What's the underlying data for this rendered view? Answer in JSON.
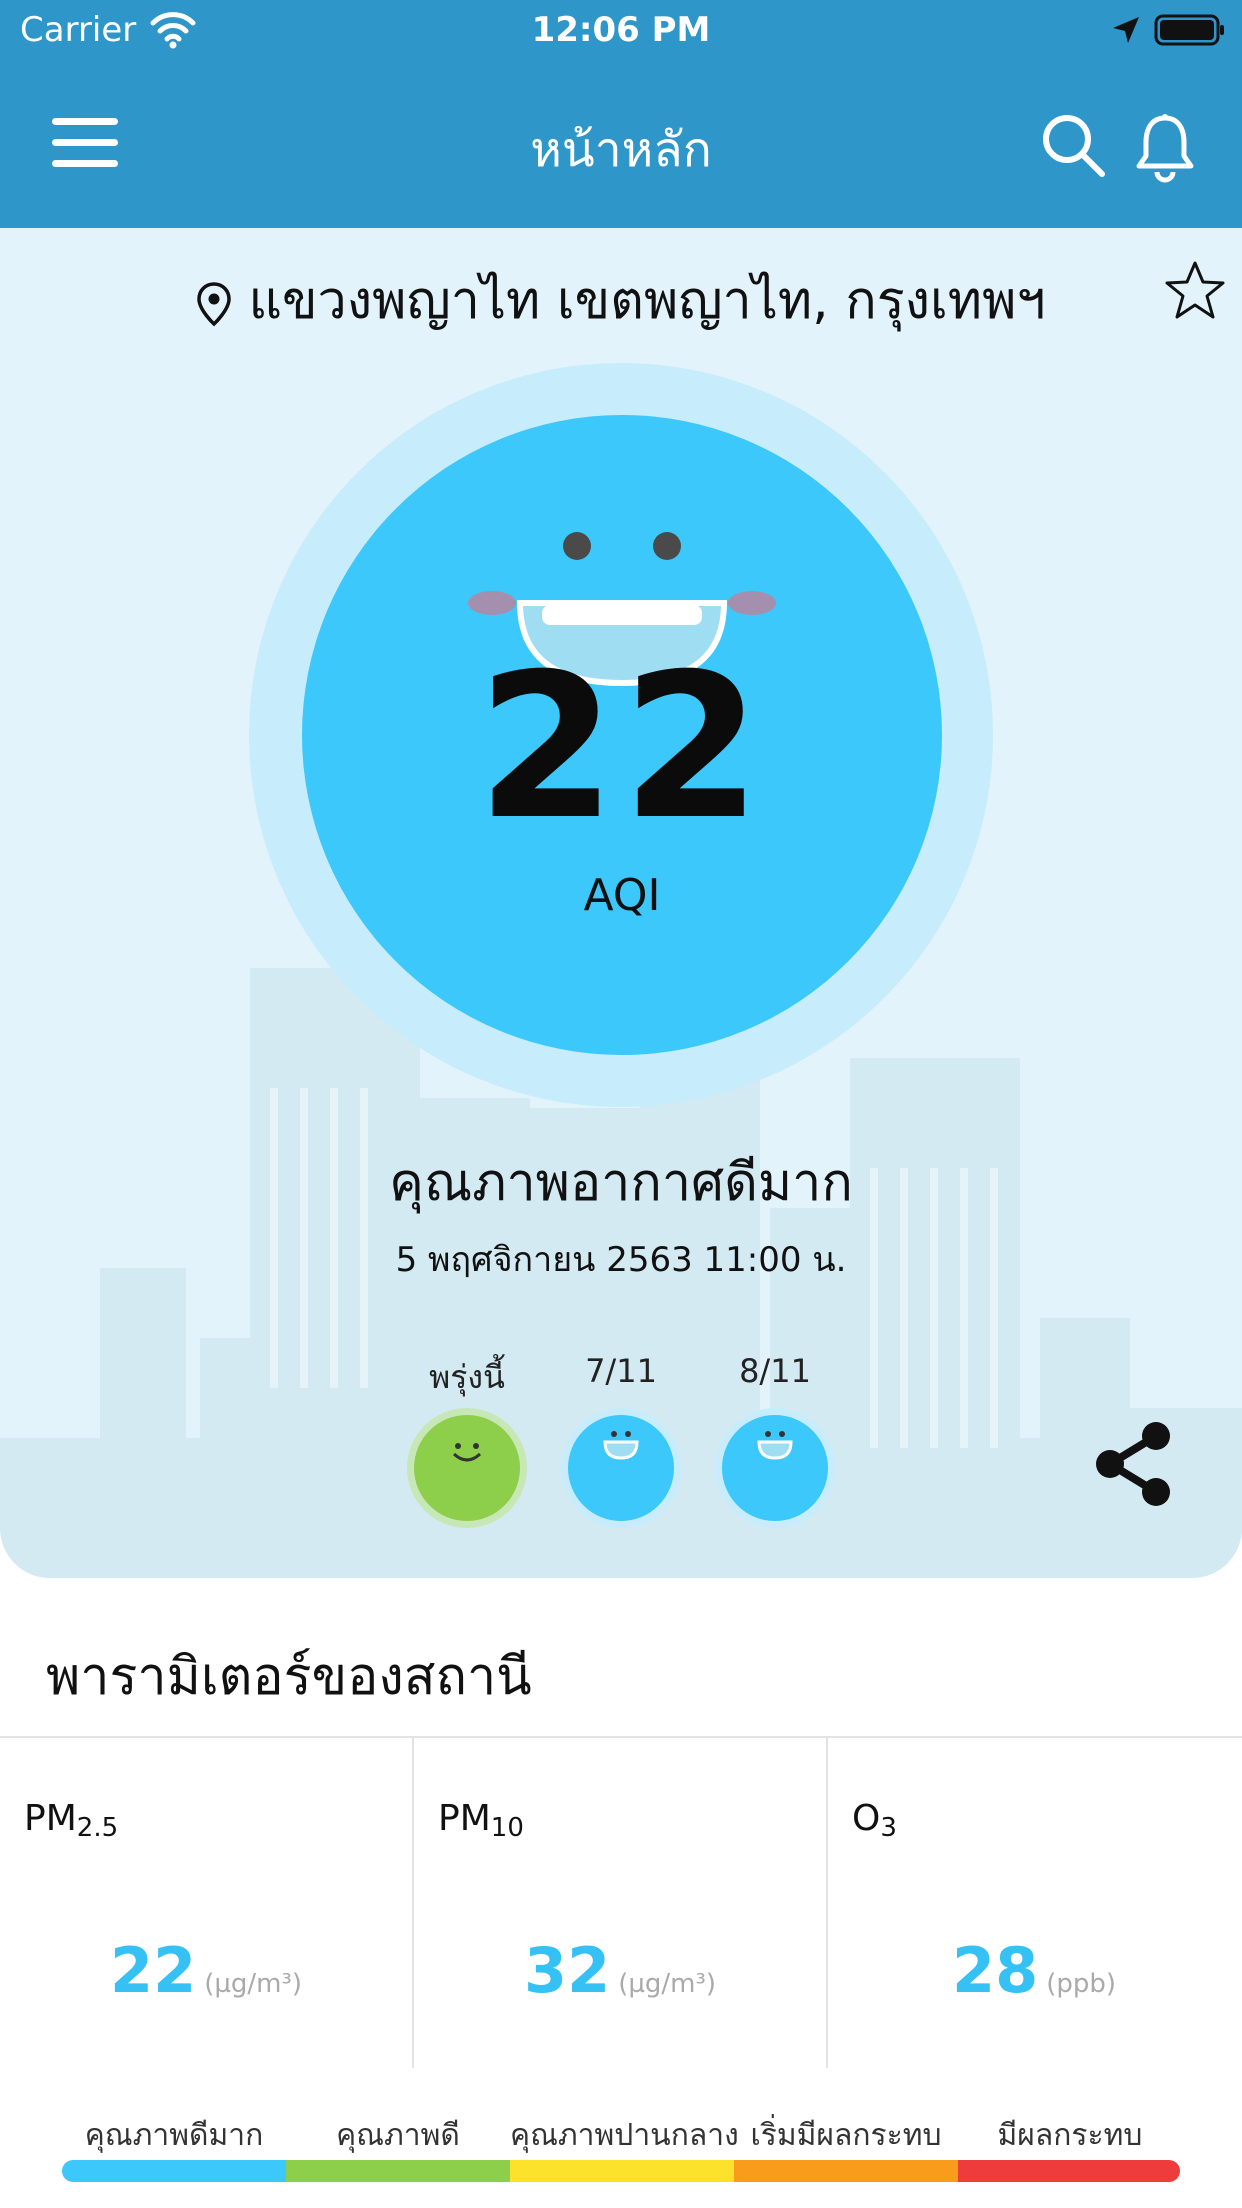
{
  "status_bar": {
    "carrier": "Carrier",
    "time": "12:06 PM"
  },
  "nav": {
    "title": "หน้าหลัก"
  },
  "location": {
    "name": "แขวงพญาไท เขตพญาไท, กรุงเทพฯ"
  },
  "aqi": {
    "value": "22",
    "label": "AQI",
    "quality": "คุณภาพอากาศดีมาก",
    "datetime": "5 พฤศจิกายน 2563  11:00 น."
  },
  "forecast": [
    {
      "label": "พรุ่งนี้",
      "color": "#8DCF4A"
    },
    {
      "label": "7/11",
      "color": "#3CC8FA"
    },
    {
      "label": "8/11",
      "color": "#3CC8FA"
    }
  ],
  "parameters": {
    "title": "พารามิเตอร์ของสถานี",
    "items": [
      {
        "name": "PM",
        "sub": "2.5",
        "value": "22",
        "unit": "(µg/m³)"
      },
      {
        "name": "PM",
        "sub": "10",
        "value": "32",
        "unit": "(µg/m³)"
      },
      {
        "name": "O",
        "sub": "3",
        "value": "28",
        "unit": "(ppb)"
      }
    ]
  },
  "legend": [
    {
      "label": "คุณภาพดีมาก",
      "color": "#3CC8FA"
    },
    {
      "label": "คุณภาพดี",
      "color": "#8DCF4A"
    },
    {
      "label": "คุณภาพปานกลาง",
      "color": "#FCE22B"
    },
    {
      "label": "เริ่มมีผลกระทบ",
      "color": "#F99C1C"
    },
    {
      "label": "มีผลกระทบ",
      "color": "#EE3B3B"
    }
  ],
  "colors": {
    "header": "#2E96C9",
    "hero_bg": "#E2F3FB",
    "aqi_circle": "#3CC8FA",
    "value_text": "#36C1F5"
  },
  "icons": [
    "wifi-icon",
    "location-arrow-icon",
    "battery-icon",
    "menu-icon",
    "search-icon",
    "bell-icon",
    "map-pin-icon",
    "star-icon",
    "share-icon"
  ]
}
